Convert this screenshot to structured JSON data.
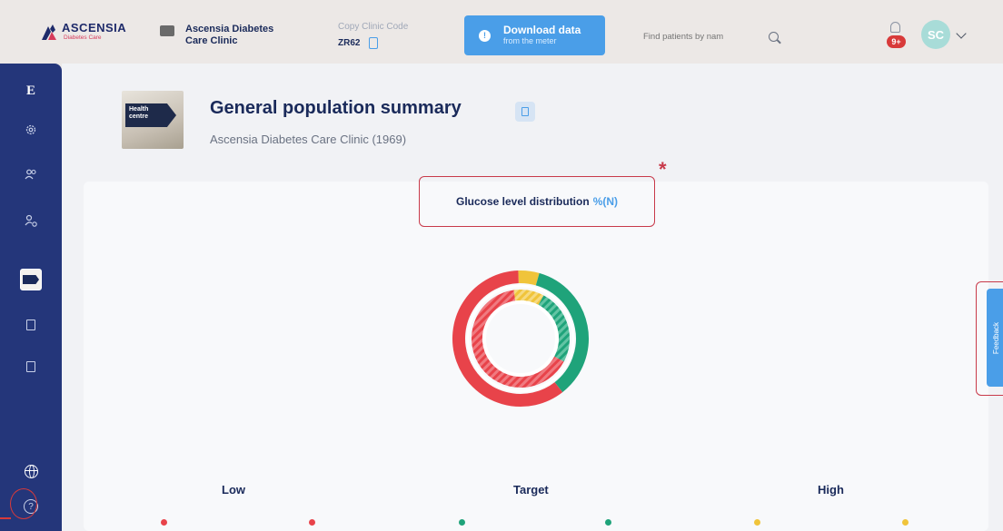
{
  "header": {
    "logo_name": "ASCENSIA",
    "logo_sub": "Diabetes Care",
    "clinic_name": "Ascensia Diabetes Care Clinic",
    "copy_code_label": "Copy Clinic Code",
    "clinic_code": "ZR62",
    "download_title": "Download data",
    "download_sub": "from the meter",
    "search_placeholder": "Find patients by nam",
    "notification_badge": "9+",
    "avatar_initials": "SC"
  },
  "sidebar": {
    "items": [
      {
        "name": "home",
        "icon": "e-logo-icon"
      },
      {
        "name": "settings",
        "icon": "gear-icon"
      },
      {
        "name": "patients",
        "icon": "users-icon"
      },
      {
        "name": "add-patient",
        "icon": "user-plus-icon"
      },
      {
        "name": "population-summary",
        "icon": "health-centre-thumbnail"
      },
      {
        "name": "report-1",
        "icon": "document-icon"
      },
      {
        "name": "report-2",
        "icon": "document-icon"
      },
      {
        "name": "language",
        "icon": "globe-icon"
      },
      {
        "name": "help",
        "icon": "help-icon"
      }
    ]
  },
  "page": {
    "title": "General population summary",
    "subtitle": "Ascensia Diabetes Care Clinic (1969)",
    "sign_text": "Health centre"
  },
  "chart": {
    "title": "Glucose level distribution",
    "unit": "%(N)",
    "asterisk": "*"
  },
  "chart_data": {
    "type": "pie",
    "title": "Glucose level distribution",
    "categories": [
      "Low",
      "Target",
      "High"
    ],
    "series": [
      {
        "name": "",
        "values": [
          60,
          35,
          5
        ]
      },
      {
        "name": "",
        "values": [
          65,
          25,
          10
        ]
      }
    ]
  },
  "legend": {
    "low": "Low",
    "target": "Target",
    "high": "High"
  },
  "feedback": {
    "label": "Feedback"
  },
  "colors": {
    "sidebar": "#24367a",
    "accent": "#4a9ee8",
    "low": "#e8434a",
    "target": "#1fa37a",
    "high": "#f0c43a",
    "annotation": "#c83a4a"
  }
}
